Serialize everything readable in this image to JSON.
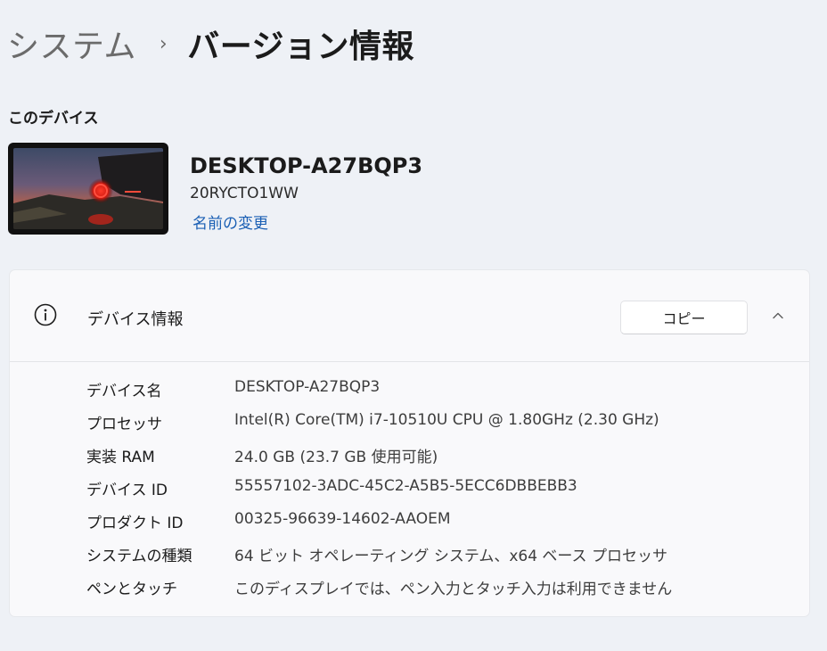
{
  "breadcrumb": {
    "parent": "システム",
    "separator": "›",
    "current": "バージョン情報"
  },
  "this_device": {
    "heading": "このデバイス",
    "name": "DESKTOP-A27BQP3",
    "model": "20RYCTO1WW",
    "rename_link": "名前の変更"
  },
  "device_specs": {
    "title": "デバイス情報",
    "copy_button": "コピー",
    "icons": {
      "info": "info-icon",
      "collapse": "chevron-up-icon"
    },
    "rows": [
      {
        "label": "デバイス名",
        "value": "DESKTOP-A27BQP3"
      },
      {
        "label": "プロセッサ",
        "value": "Intel(R) Core(TM) i7-10510U CPU @ 1.80GHz (2.30 GHz)"
      },
      {
        "label": "実装 RAM",
        "value": "24.0 GB (23.7 GB 使用可能)"
      },
      {
        "label": "デバイス ID",
        "value": "55557102-3ADC-45C2-A5B5-5ECC6DBBEBB3"
      },
      {
        "label": "プロダクト ID",
        "value": "00325-96639-14602-AAOEM"
      },
      {
        "label": "システムの種類",
        "value": "64 ビット オペレーティング システム、x64 ベース プロセッサ"
      },
      {
        "label": "ペンとタッチ",
        "value": "このディスプレイでは、ペン入力とタッチ入力は利用できません"
      }
    ]
  },
  "colors": {
    "background": "#eef1f6",
    "card": "#f9f9fb",
    "link": "#1a5fb4"
  }
}
